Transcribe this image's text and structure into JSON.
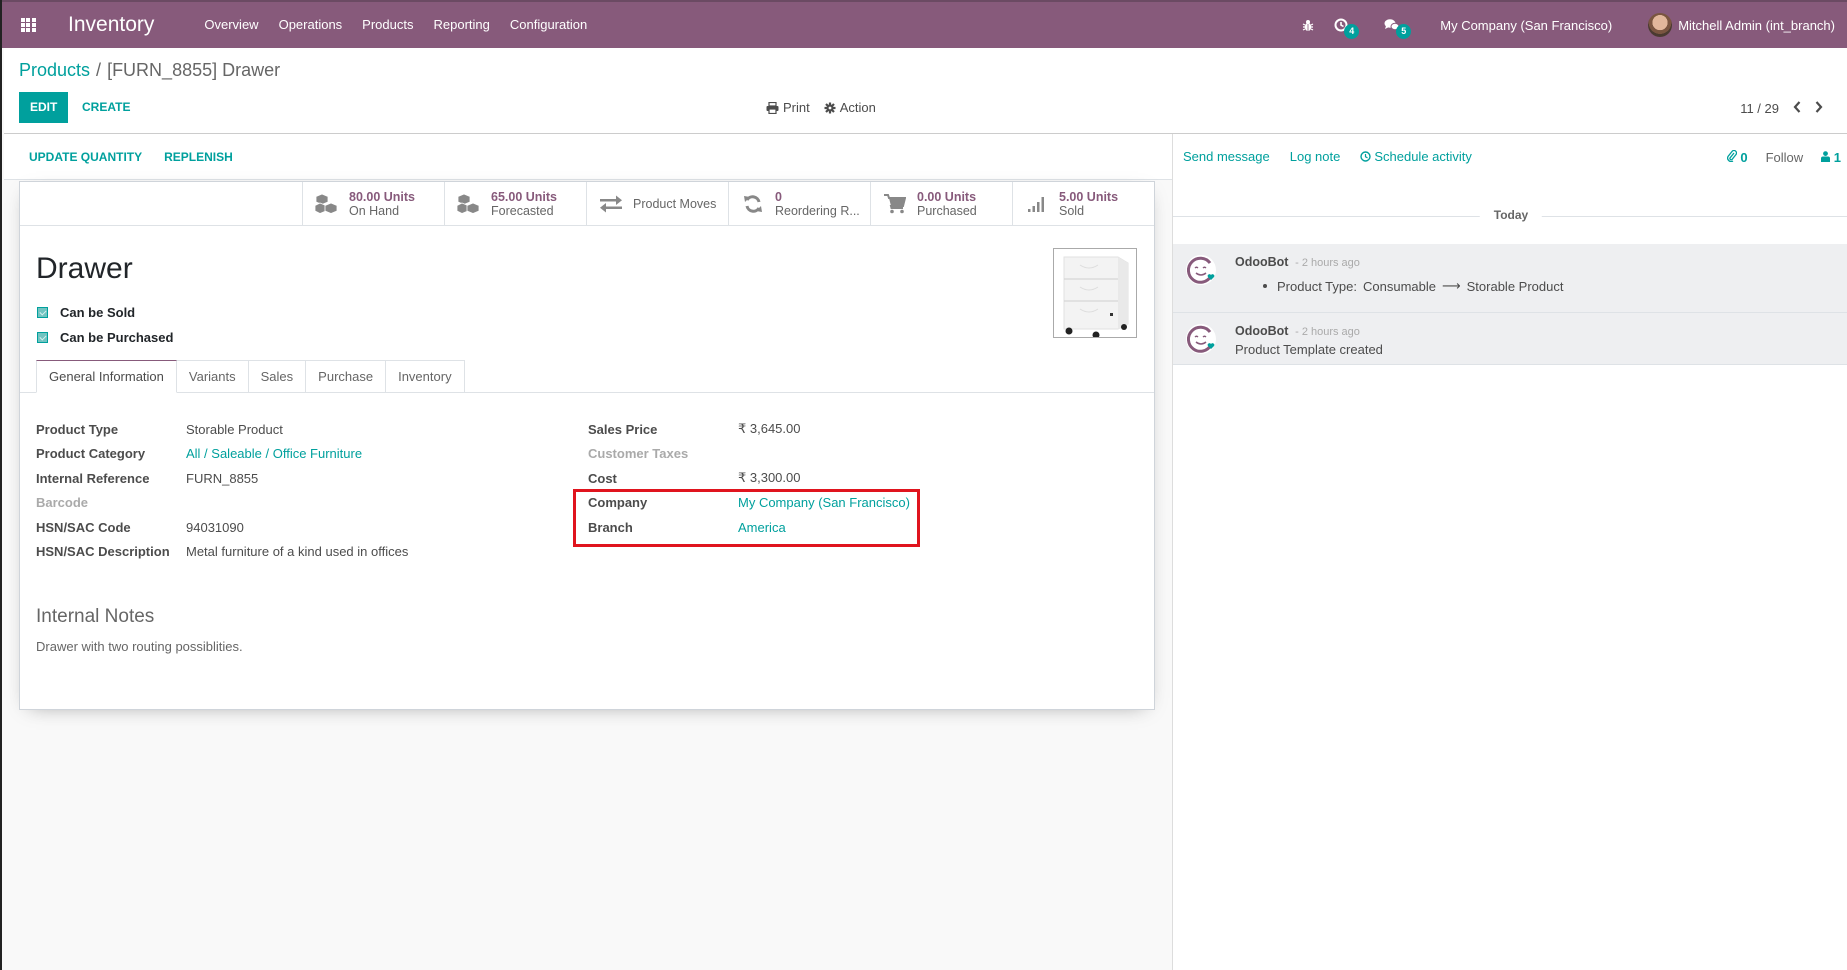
{
  "navbar": {
    "app_name": "Inventory",
    "menu": [
      "Overview",
      "Operations",
      "Products",
      "Reporting",
      "Configuration"
    ],
    "activity_count": "4",
    "message_count": "5",
    "company": "My Company (San Francisco)",
    "user": "Mitchell Admin (int_branch)"
  },
  "control_panel": {
    "breadcrumb_parent": "Products",
    "breadcrumb_current": "[FURN_8855] Drawer",
    "edit_label": "EDIT",
    "create_label": "CREATE",
    "print_label": "Print",
    "action_label": "Action",
    "pager": "11 / 29"
  },
  "statusbar": {
    "buttons": [
      "UPDATE QUANTITY",
      "REPLENISH"
    ]
  },
  "stat_buttons": [
    {
      "icon": "cubes-icon",
      "value": "80.00 Units",
      "label": "On Hand"
    },
    {
      "icon": "cubes-icon",
      "value": "65.00 Units",
      "label": "Forecasted"
    },
    {
      "icon": "exchange-icon",
      "value": "",
      "label": "Product Moves"
    },
    {
      "icon": "refresh-icon",
      "value": "0",
      "label": "Reordering R..."
    },
    {
      "icon": "cart-icon",
      "value": "0.00 Units",
      "label": "Purchased"
    },
    {
      "icon": "signal-icon",
      "value": "5.00 Units",
      "label": "Sold"
    }
  ],
  "product": {
    "name": "Drawer",
    "can_be_sold_label": "Can be Sold",
    "can_be_sold": true,
    "can_be_purchased_label": "Can be Purchased",
    "can_be_purchased": true
  },
  "tabs": [
    "General Information",
    "Variants",
    "Sales",
    "Purchase",
    "Inventory"
  ],
  "active_tab": "General Information",
  "left_fields": [
    {
      "label": "Product Type",
      "value": "Storable Product",
      "link": false,
      "muted": false
    },
    {
      "label": "Product Category",
      "value": "All / Saleable / Office Furniture",
      "link": true,
      "muted": false
    },
    {
      "label": "Internal Reference",
      "value": "FURN_8855",
      "link": false,
      "muted": false
    },
    {
      "label": "Barcode",
      "value": "",
      "link": false,
      "muted": true
    },
    {
      "label": "HSN/SAC Code",
      "value": "94031090",
      "link": false,
      "muted": false
    },
    {
      "label": "HSN/SAC Description",
      "value": "Metal furniture of a kind used in offices",
      "link": false,
      "muted": false
    }
  ],
  "right_fields": [
    {
      "label": "Sales Price",
      "value": "₹ 3,645.00",
      "link": false,
      "muted": false
    },
    {
      "label": "Customer Taxes",
      "value": "",
      "link": false,
      "muted": true
    },
    {
      "label": "Cost",
      "value": "₹ 3,300.00",
      "link": false,
      "muted": false
    },
    {
      "label": "Company",
      "value": "My Company (San Francisco)",
      "link": true,
      "muted": false
    },
    {
      "label": "Branch",
      "value": "America",
      "link": true,
      "muted": false
    }
  ],
  "notes": {
    "title": "Internal Notes",
    "text": "Drawer with two routing possiblities."
  },
  "chatter": {
    "send_message": "Send message",
    "log_note": "Log note",
    "schedule_activity": "Schedule activity",
    "attachments": "0",
    "follow": "Follow",
    "followers": "1",
    "date_separator": "Today",
    "messages": [
      {
        "author": "OdooBot",
        "time": "- 2 hours ago",
        "tracking_field": "Product Type:",
        "old": "Consumable",
        "arrow": "⟶",
        "new": "Storable Product"
      },
      {
        "author": "OdooBot",
        "time": "- 2 hours ago",
        "body": "Product Template created"
      }
    ]
  },
  "colors": {
    "brand": "#875A7B",
    "accent": "#00A09D",
    "highlight": "#e0141e"
  }
}
